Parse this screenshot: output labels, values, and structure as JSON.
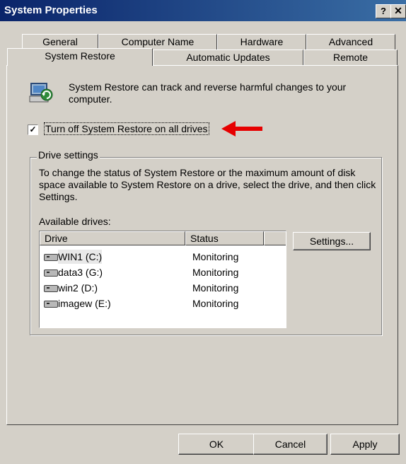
{
  "window": {
    "title": "System Properties",
    "help_label": "?",
    "close_label": "✕"
  },
  "tabs_row1": [
    "General",
    "Computer Name",
    "Hardware",
    "Advanced"
  ],
  "tabs_row2": [
    "System Restore",
    "Automatic Updates",
    "Remote"
  ],
  "active_tab": "System Restore",
  "intro_text": "System Restore can track and reverse harmful changes to your computer.",
  "checkbox": {
    "label": "Turn off System Restore on all drives",
    "checked": true,
    "check_glyph": "✓"
  },
  "drive_settings": {
    "title": "Drive settings",
    "description": "To change the status of System Restore or the maximum amount of disk space available to System Restore on a drive, select the drive, and then click Settings.",
    "available_label": "Available drives:",
    "columns": [
      "Drive",
      "Status"
    ],
    "drives": [
      {
        "name": "WIN1 (C:)",
        "status": "Monitoring"
      },
      {
        "name": "data3 (G:)",
        "status": "Monitoring"
      },
      {
        "name": "win2 (D:)",
        "status": "Monitoring"
      },
      {
        "name": "imagew (E:)",
        "status": "Monitoring"
      }
    ],
    "settings_button": "Settings..."
  },
  "buttons": {
    "ok": "OK",
    "cancel": "Cancel",
    "apply": "Apply"
  },
  "colors": {
    "titlebar_start": "#0a246a",
    "titlebar_end": "#3a6ea5",
    "face": "#d4d0c8",
    "annotation_arrow": "#e60000"
  },
  "icons": [
    "system-restore-icon",
    "red-annotation-arrow",
    "drive-icon"
  ]
}
